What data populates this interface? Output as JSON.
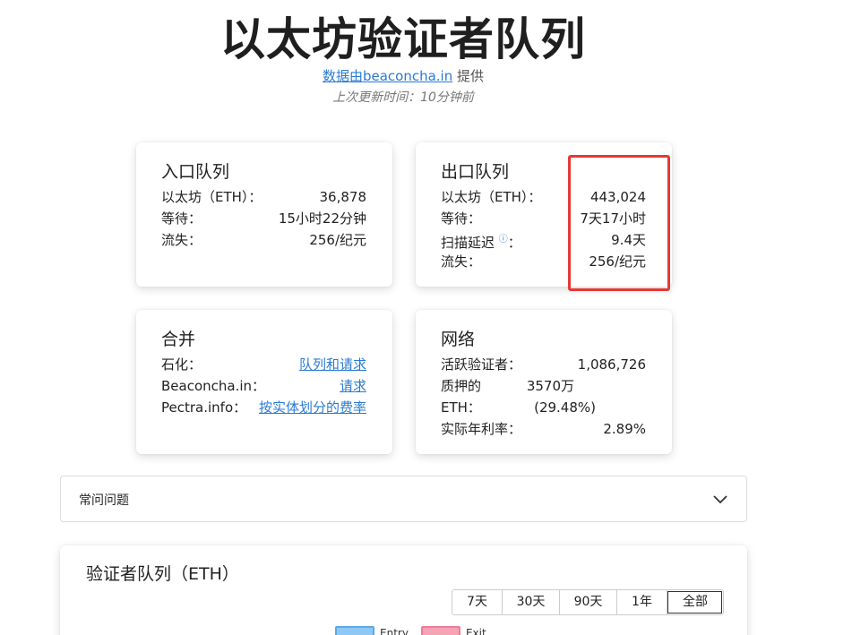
{
  "header": {
    "title": "以太坊验证者队列",
    "source_link": "数据由beaconcha.in",
    "source_suffix": " 提供",
    "updated": "上次更新时间：10分钟前"
  },
  "entry_queue": {
    "title": "入口队列",
    "rows": [
      {
        "label": "以太坊（ETH）：",
        "value": "36,878"
      },
      {
        "label": "等待：",
        "value": "15小时22分钟"
      },
      {
        "label": "流失：",
        "value": "256/纪元"
      }
    ]
  },
  "exit_queue": {
    "title": "出口队列",
    "rows": [
      {
        "label": "以太坊（ETH）：",
        "value": "443,024"
      },
      {
        "label": "等待：",
        "value": "7天17小时"
      },
      {
        "label": "扫描延迟",
        "info": "ⓘ",
        "colon": "：",
        "value": "9.4天"
      },
      {
        "label": "流失：",
        "value": "256/纪元"
      }
    ]
  },
  "merge": {
    "title": "合并",
    "rows": [
      {
        "label": "石化：",
        "value": "队列和请求"
      },
      {
        "label": "Beaconcha.in：",
        "value": "请求"
      },
      {
        "label": "Pectra.info：",
        "value": "按实体划分的费率"
      }
    ]
  },
  "network": {
    "title": "网络",
    "rows": [
      {
        "label": "活跃验证者：",
        "value": "1,086,726"
      },
      {
        "label": "质押的",
        "value": "3570万"
      },
      {
        "label": "ETH：",
        "value": "(29.48%)"
      },
      {
        "label": "实际年利率：",
        "value": "2.89%"
      }
    ]
  },
  "faq": {
    "label": "常问问题"
  },
  "chart": {
    "title": "验证者队列（ETH）",
    "ranges": [
      "7天",
      "30天",
      "90天",
      "1年",
      "全部"
    ],
    "active_range": "全部",
    "legend": [
      {
        "name": "Entry",
        "color": "#90c8f5"
      },
      {
        "name": "Exit",
        "color": "#f5a3b5"
      }
    ]
  },
  "colors": {
    "accent": "#2a7bd4",
    "highlight": "#e53935"
  }
}
